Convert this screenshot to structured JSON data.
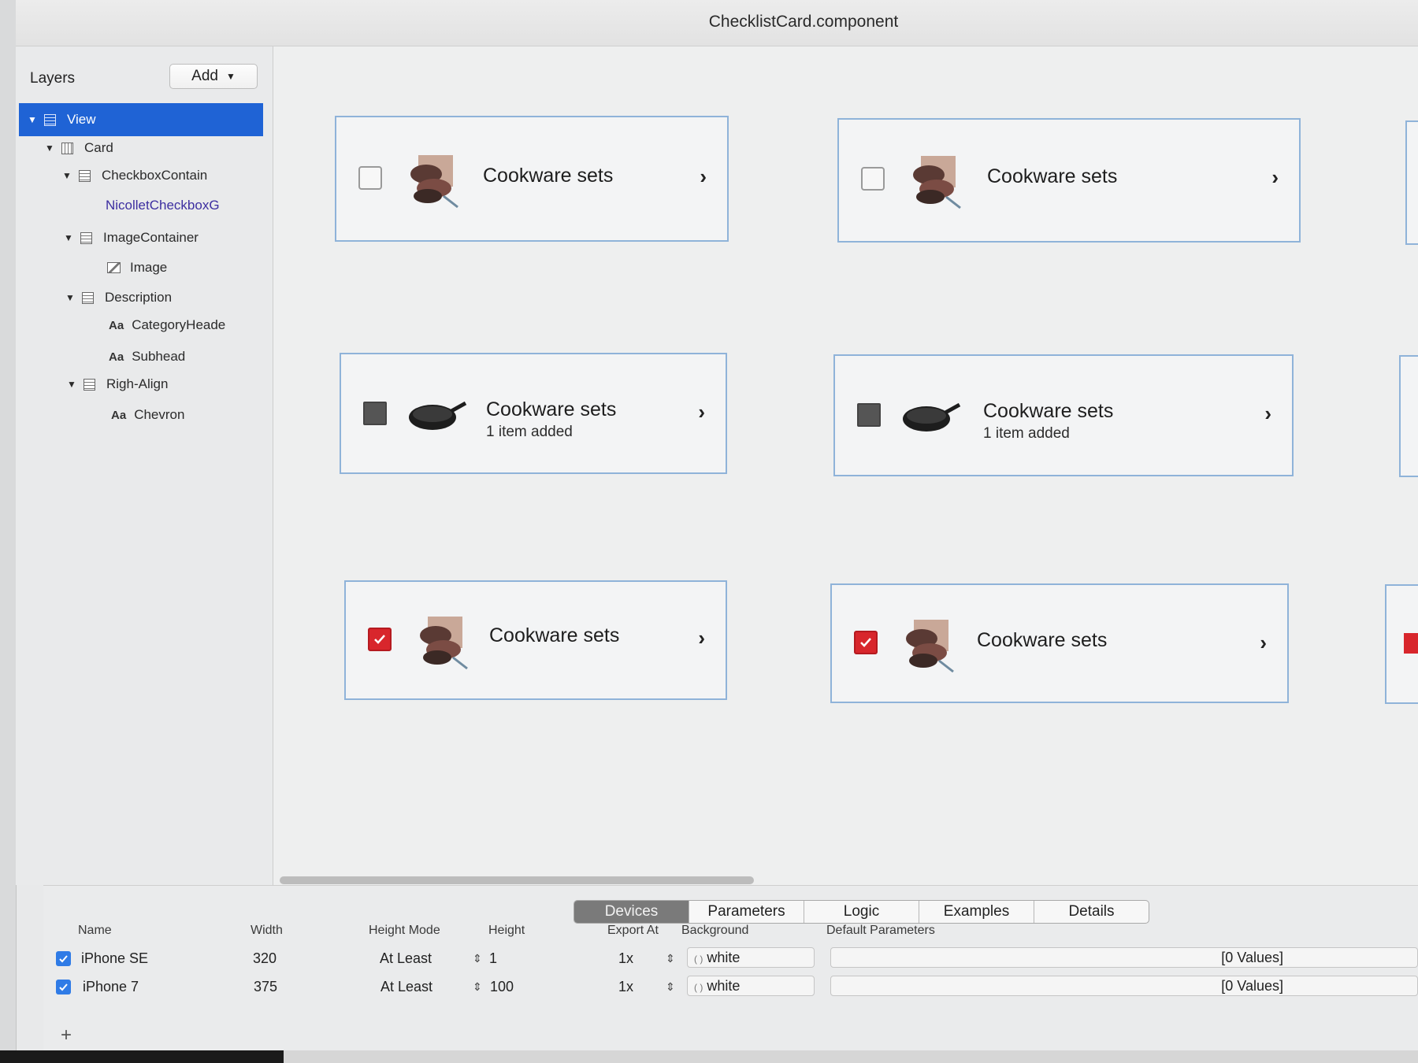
{
  "window": {
    "title": "ChecklistCard.component"
  },
  "sidebar": {
    "header": "Layers",
    "add_label": "Add",
    "items": [
      {
        "label": "View",
        "indent": 0,
        "icon": "stack-layout-icon",
        "expanded": true,
        "selected": true
      },
      {
        "label": "Card",
        "indent": 1,
        "icon": "columns-layout-icon",
        "expanded": true
      },
      {
        "label": "CheckboxContain",
        "indent": 2,
        "icon": "stack-layout-icon",
        "expanded": true
      },
      {
        "label": "NicolletCheckboxG",
        "indent": 3,
        "icon": "component-instance",
        "component": true
      },
      {
        "label": "ImageContainer",
        "indent": 2,
        "icon": "stack-layout-icon",
        "expanded": true
      },
      {
        "label": "Image",
        "indent": 3,
        "icon": "image-icon"
      },
      {
        "label": "Description",
        "indent": 2,
        "icon": "stack-layout-icon",
        "expanded": true
      },
      {
        "label": "CategoryHeade",
        "indent": 3,
        "icon": "text-icon"
      },
      {
        "label": "Subhead",
        "indent": 3,
        "icon": "text-icon"
      },
      {
        "label": "Righ-Align",
        "indent": 2,
        "icon": "stack-layout-icon",
        "expanded": true
      },
      {
        "label": "Chevron",
        "indent": 3,
        "icon": "text-icon"
      }
    ]
  },
  "canvas": {
    "cards": [
      {
        "title": "Cookware sets",
        "subhead": "",
        "checkbox": "unchecked",
        "image": "cookware-set"
      },
      {
        "title": "Cookware sets",
        "subhead": "",
        "checkbox": "unchecked",
        "image": "cookware-set"
      },
      {
        "title": "Cookware sets",
        "subhead": "1 item added",
        "checkbox": "partial",
        "image": "skillet"
      },
      {
        "title": "Cookware sets",
        "subhead": "1 item added",
        "checkbox": "partial",
        "image": "skillet"
      },
      {
        "title": "Cookware sets",
        "subhead": "",
        "checkbox": "checked",
        "image": "cookware-set"
      },
      {
        "title": "Cookware sets",
        "subhead": "",
        "checkbox": "checked",
        "image": "cookware-set"
      }
    ],
    "chevron": "›"
  },
  "bottom": {
    "tabs": [
      "Devices",
      "Parameters",
      "Logic",
      "Examples",
      "Details"
    ],
    "active_tab": "Devices",
    "columns": [
      "Name",
      "Width",
      "Height Mode",
      "Height",
      "Export At",
      "Background",
      "Default Parameters"
    ],
    "rows": [
      {
        "name": "iPhone SE",
        "width": "320",
        "height_mode": "At Least",
        "height": "1",
        "export_at": "1x",
        "background": "white",
        "default_parameters": "[0 Values]",
        "enabled": true
      },
      {
        "name": "iPhone 7",
        "width": "375",
        "height_mode": "At Least",
        "height": "100",
        "export_at": "1x",
        "background": "white",
        "default_parameters": "[0 Values]",
        "enabled": true
      }
    ],
    "add_symbol": "+"
  },
  "colors": {
    "selection": "#1f63d5",
    "checkbox_checked": "#d8262c",
    "card_border": "#8fb3d9"
  }
}
